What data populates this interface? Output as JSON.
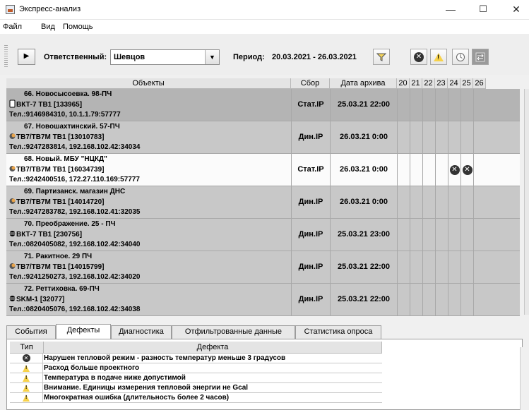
{
  "window": {
    "title": "Экспресс-анализ",
    "minimize": "—",
    "maximize": "☐",
    "close": "✕"
  },
  "menu": [
    "Файл",
    "Вид",
    "Помощь"
  ],
  "toolbar": {
    "responsible_label": "Ответственный:",
    "responsible_value": "Шевцов",
    "period_label": "Период:",
    "period_value": "20.03.2021 - 26.03.2021"
  },
  "table": {
    "headers": {
      "objects": "Объекты",
      "sbor": "Сбор",
      "archive_date": "Дата архива",
      "days": [
        "20",
        "21",
        "22",
        "23",
        "24",
        "25",
        "26"
      ]
    },
    "rows": [
      {
        "line1": "66. Новосысоевка. 98-ПЧ",
        "line2": "ВКТ-7 ТВ1 [133965]",
        "line3": "Тел.:9146984310, 10.1.1.79:57777",
        "sbor": "Стат.IP",
        "date": "25.03.21 22:00",
        "device_icon": "battery-icon",
        "style": "dark",
        "day_icons": []
      },
      {
        "line1": "67. Новошахтинский. 57-ПЧ",
        "line2": "ТВ7/ТВ7М ТВ1 [13010783]",
        "line3": "Тел.:9247283814, 192.168.102.42:34034",
        "sbor": "Дин.IP",
        "date": "26.03.21 0:00",
        "device_icon": "moon-icon",
        "style": "gray",
        "day_icons": []
      },
      {
        "line1": "68. Новый. МБУ \"НЦКД\"",
        "line2": "ТВ7/ТВ7М ТВ1 [16034739]",
        "line3": "Тел.:9242400516, 172.27.110.169:57777",
        "sbor": "Стат.IP",
        "date": "26.03.21 0:00",
        "device_icon": "moon-icon",
        "style": "white",
        "day_icons": [
          4,
          5
        ]
      },
      {
        "line1": "69. Партизанск. магазин ДНС",
        "line2": "ТВ7/ТВ7М ТВ1 [14014720]",
        "line3": "Тел.:9247283782, 192.168.102.41:32035",
        "sbor": "Дин.IP",
        "date": "26.03.21 0:00",
        "device_icon": "moon-icon",
        "style": "gray",
        "day_icons": []
      },
      {
        "line1": "70. Преображение. 25 - ПЧ",
        "line2": "ВКТ-7 ТВ1 [230756]",
        "line3": "Тел.:0820405082, 192.168.102.42:34040",
        "sbor": "Дин.IP",
        "date": "25.03.21 23:00",
        "device_icon": "lines-icon",
        "style": "gray",
        "day_icons": []
      },
      {
        "line1": "71. Ракитное. 29 ПЧ",
        "line2": "ТВ7/ТВ7М ТВ1 [14015799]",
        "line3": "Тел.:9241250273, 192.168.102.42:34020",
        "sbor": "Дин.IP",
        "date": "25.03.21 22:00",
        "device_icon": "moon-icon",
        "style": "gray",
        "day_icons": []
      },
      {
        "line1": "72. Реттиховка. 69-ПЧ",
        "line2": "SKM-1 [32077]",
        "line3": "Тел.:0820405076, 192.168.102.42:34038",
        "sbor": "Дин.IP",
        "date": "25.03.21 22:00",
        "device_icon": "lines-icon",
        "style": "gray",
        "day_icons": []
      }
    ]
  },
  "tabs": [
    "События",
    "Дефекты",
    "Диагностика",
    "Отфильтрованные данные",
    "Статистика опроса"
  ],
  "defects": {
    "header_type": "Тип",
    "header_defect": "Дефекта",
    "rows": [
      {
        "icon": "error-icon",
        "text": "Нарушен тепловой режим - разность температур меньше 3 градусов"
      },
      {
        "icon": "warning-icon",
        "text": "Расход больше проектного"
      },
      {
        "icon": "warning-icon",
        "text": "Температура в подаче ниже допустимой"
      },
      {
        "icon": "warning-icon",
        "text": "Внимание. Единицы измерения тепловой энергии не Gcal"
      },
      {
        "icon": "warning-icon",
        "text": "Многократная ошибка (длительность более 2 часов)"
      }
    ]
  }
}
